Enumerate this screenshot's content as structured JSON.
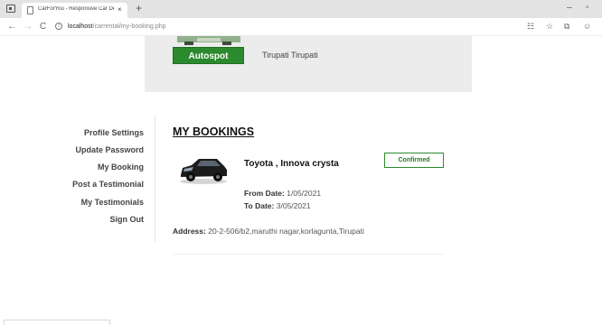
{
  "browser": {
    "tab_title": "CarForYou - Responsive Car Dea",
    "tab_close": "×",
    "new_tab": "+",
    "url_host": "localhost",
    "url_path": "/carrental/my-booking.php",
    "back": "←",
    "forward": "→",
    "reload": "C"
  },
  "header": {
    "brand_button": "Autospot",
    "location": "Tirupati Tirupati"
  },
  "sidebar": {
    "items": [
      {
        "label": "Profile Settings"
      },
      {
        "label": "Update Password"
      },
      {
        "label": "My Booking"
      },
      {
        "label": "Post a Testimonial"
      },
      {
        "label": "My Testimonials"
      },
      {
        "label": "Sign Out"
      }
    ]
  },
  "main": {
    "title": "MY BOOKINGS",
    "booking": {
      "vehicle": "Toyota , Innova crysta",
      "status": "Confirmed",
      "from_label": "From Date:",
      "from_value": "1/05/2021",
      "to_label": "To Date:",
      "to_value": "3/05/2021",
      "address_label": "Address:",
      "address_value": "20-2-506/b2,maruthi nagar,korlagunta,Tirupati"
    }
  },
  "colors": {
    "accent_green": "#2b8a2e",
    "panel_grey": "#ececec"
  }
}
